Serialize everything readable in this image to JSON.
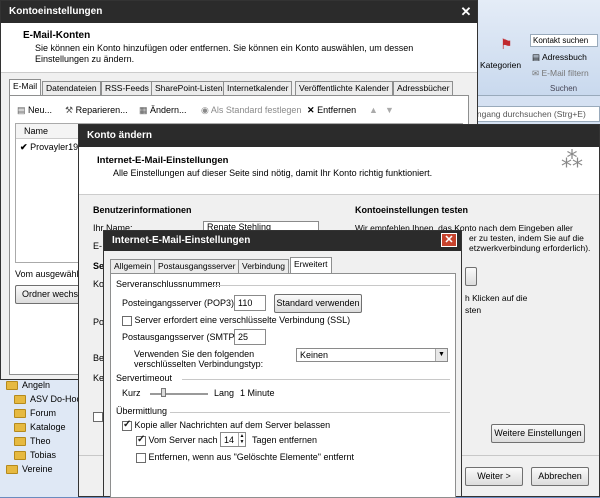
{
  "outlook": {
    "ribbon": {
      "categories": "Kategorien",
      "contact_search": "Kontakt suchen",
      "address_book": "Adressbuch",
      "email_filter": "E-Mail filtern",
      "search_group": "Suchen"
    },
    "search_placeholder": "ingang durchsuchen (Strg+E)",
    "folders": [
      "Angeln",
      "ASV Do-Hoch",
      "Forum",
      "Kataloge",
      "Theo",
      "Tobias",
      "Vereine"
    ]
  },
  "konto": {
    "title": "Kontoeinstellungen",
    "heading": "E-Mail-Konten",
    "description": "Sie können ein Konto hinzufügen oder entfernen. Sie können ein Konto auswählen, um dessen Einstellungen zu ändern.",
    "tabs": [
      "E-Mail",
      "Datendateien",
      "RSS-Feeds",
      "SharePoint-Listen",
      "Internetkalender",
      "Veröffentlichte Kalender",
      "Adressbücher"
    ],
    "toolbar": {
      "new": "Neu...",
      "repair": "Reparieren...",
      "change": "Ändern...",
      "set_default": "Als Standard festlegen",
      "remove": "Entfernen"
    },
    "column_name": "Name",
    "account": "Provayler19",
    "selected_label": "Vom ausgewählte",
    "folder_button": "Ordner wechse"
  },
  "aendern": {
    "title": "Konto ändern",
    "heading": "Internet-E-Mail-Einstellungen",
    "description": "Alle Einstellungen auf dieser Seite sind nötig, damit Ihr Konto richtig funktioniert.",
    "user_info": "Benutzerinformationen",
    "name_label": "Ihr Name:",
    "name_value": "Renate Stehling",
    "email_label": "E-",
    "partial_labels": [
      "Se",
      "Ko",
      "Po",
      "Be",
      "Ke"
    ],
    "test_heading": "Kontoeinstellungen testen",
    "test_text": "Wir empfehlen Ihnen, das Konto nach dem Eingeben aller",
    "test_text2": "er zu testen, indem Sie auf die",
    "test_text3": "etzwerkverbindung erforderlich).",
    "test_text4": "h Klicken auf die",
    "test_text5": "sten",
    "more_settings": "Weitere Einstellungen",
    "next": "Weiter >",
    "cancel": "Abbrechen"
  },
  "inet": {
    "title": "Internet-E-Mail-Einstellungen",
    "tabs": [
      "Allgemein",
      "Postausgangsserver",
      "Verbindung",
      "Erweitert"
    ],
    "group_ports": "Serveranschlussnummern",
    "pop3_label": "Posteingangsserver (POP3):",
    "pop3_value": "110",
    "default_button": "Standard verwenden",
    "ssl_label": "Server erfordert eine verschlüsselte Verbindung (SSL)",
    "smtp_label": "Postausgangsserver (SMTP):",
    "smtp_value": "25",
    "enc_label1": "Verwenden Sie den folgenden",
    "enc_label2": "verschlüsselten Verbindungstyp:",
    "enc_value": "Keinen",
    "group_timeout": "Servertimeout",
    "short": "Kurz",
    "long": "Lang",
    "timeout_value": "1 Minute",
    "timeout_level": 0.2,
    "group_delivery": "Übermittlung",
    "keep_copy": "Kopie aller Nachrichten auf dem Server belassen",
    "remove_after": "Vom Server nach",
    "days_value": "14",
    "days_label": "Tagen entfernen",
    "remove_deleted": "Entfernen, wenn aus \"Gelöschte Elemente\" entfernt"
  }
}
